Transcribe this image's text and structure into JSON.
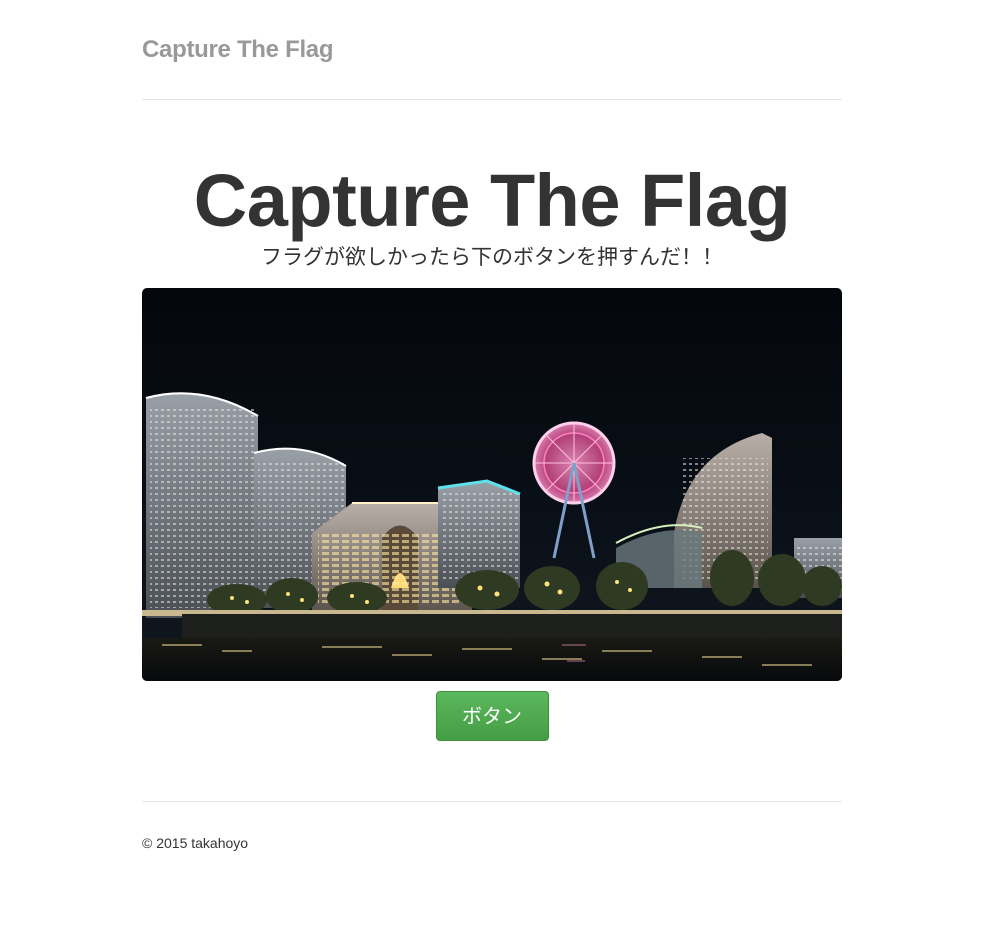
{
  "header": {
    "brand": "Capture The Flag"
  },
  "jumbotron": {
    "title": "Capture The Flag",
    "lead": "フラグが欲しかったら下のボタンを押すんだ！！",
    "image_description_icon": "night-city-photo"
  },
  "action": {
    "button_label": "ボタン"
  },
  "footer": {
    "copyright": "© 2015 takahoyo"
  },
  "colors": {
    "brand_muted": "#999999",
    "text": "#333333",
    "button_green": "#5cb85c",
    "divider": "#e5e5e5"
  }
}
